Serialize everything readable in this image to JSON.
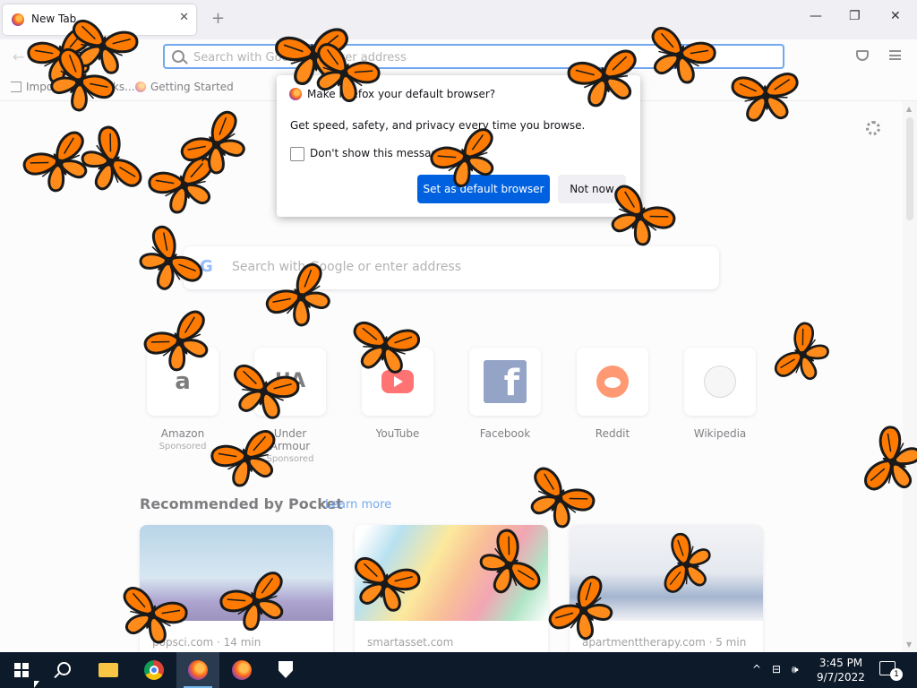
{
  "tab": {
    "title": "New Tab",
    "close": "✕",
    "new_tab": "+"
  },
  "window_controls": {
    "minimize": "—",
    "restore": "❐",
    "close": "✕"
  },
  "urlbar": {
    "placeholder": "Search with Google or enter address"
  },
  "bookmarks": [
    {
      "label": "Import bookmarks...",
      "icon": "import-icon"
    },
    {
      "label": "Getting Started",
      "icon": "firefox-icon"
    }
  ],
  "dialog": {
    "title": "Make Firefox your default browser?",
    "body": "Get speed, safety, and privacy every time you browse.",
    "checkbox_label": "Don't show this message again",
    "primary_button": "Set as default browser",
    "secondary_button": "Not now"
  },
  "search": {
    "placeholder": "Search with Google or enter address",
    "logo": "G"
  },
  "top_sites": [
    {
      "name": "Amazon",
      "sponsored": "Sponsored",
      "logo": "a"
    },
    {
      "name": "Under Armour",
      "sponsored": "Sponsored",
      "logo": "UA"
    },
    {
      "name": "YouTube",
      "sponsored": ""
    },
    {
      "name": "Facebook",
      "sponsored": "",
      "logo": "f"
    },
    {
      "name": "Reddit",
      "sponsored": ""
    },
    {
      "name": "Wikipedia",
      "sponsored": ""
    }
  ],
  "pocket": {
    "title": "Recommended by Pocket",
    "learn_more": "Learn more",
    "cards": [
      {
        "source": "popsci.com · 14 min"
      },
      {
        "source": "smartasset.com"
      },
      {
        "source": "apartmenttherapy.com · 5 min"
      }
    ]
  },
  "taskbar": {
    "items": [
      "start",
      "search",
      "file-explorer",
      "chrome",
      "firefox",
      "firefox",
      "windows-security"
    ],
    "tray_chevron": "^",
    "time": "3:45 PM",
    "date": "9/7/2022",
    "notification_count": "1"
  },
  "colors": {
    "accent": "#0061e0",
    "butterfly_orange": "#ff7a00",
    "butterfly_black": "#1a1a1a",
    "taskbar": "#0d1a2a"
  }
}
